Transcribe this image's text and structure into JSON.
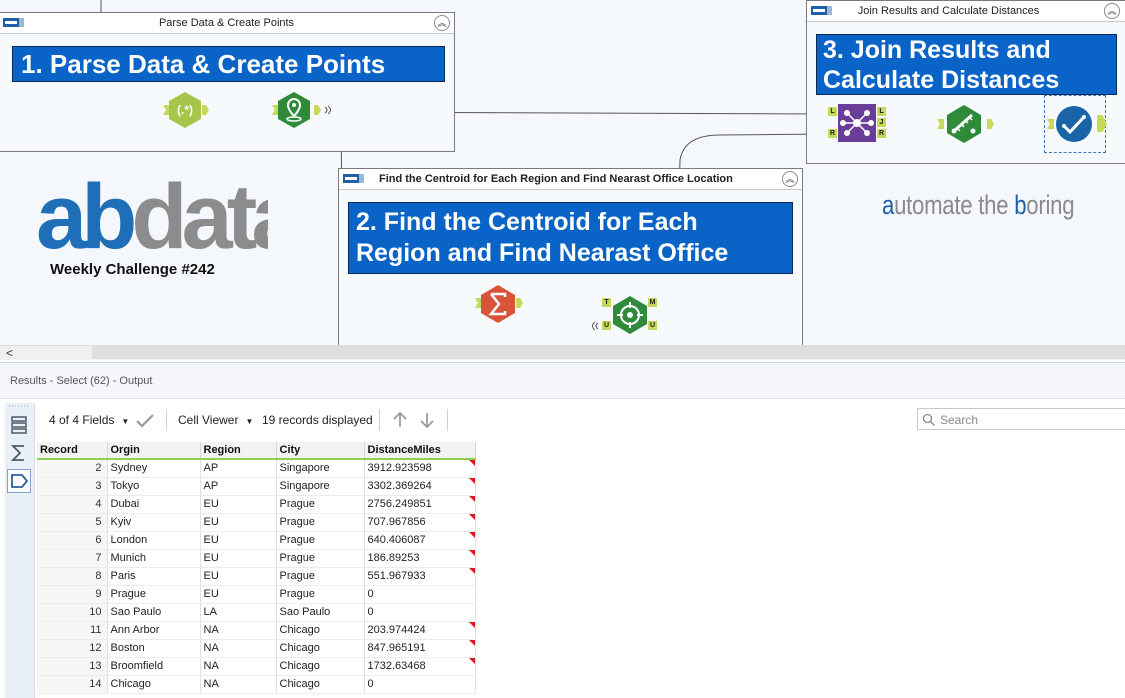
{
  "canvas": {
    "container1": {
      "title": "Parse Data & Create Points",
      "annotation": "1. Parse Data & Create Points"
    },
    "container2": {
      "title": "Find the Centroid for Each Region and Find Nearast Office Location",
      "annotation_line1": "2. Find the Centroid for Each",
      "annotation_line2": "Region and Find Nearast Office"
    },
    "container3": {
      "title": "Join Results and Calculate Distances",
      "annotation_line1": "3. Join Results and",
      "annotation_line2": "Calculate Distances"
    },
    "regex_tool_label": "(.*)",
    "logo_text": "abdata",
    "challenge_label": "Weekly Challenge #242",
    "tagline_parts": [
      "a",
      "utomate the ",
      "b",
      "oring"
    ],
    "anchor_labels": {
      "join_left": "L",
      "join_j": "J",
      "join_right": "R",
      "join_left_in": "L",
      "join_right_in": "R",
      "spatial_target": "T",
      "spatial_match": "M",
      "spatial_unmatched": "U",
      "spatial_universe": "U"
    },
    "icons": [
      "container-icon",
      "collapse-icon",
      "regex-icon",
      "create-points-icon",
      "summarize-icon",
      "spatial-match-icon",
      "join-icon",
      "distance-icon",
      "select-icon"
    ]
  },
  "scrollbar": {
    "left_arrow": "<"
  },
  "results": {
    "title": "Results - Select (62) - Output",
    "fields_label": "4 of 4 Fields",
    "cell_viewer_label": "Cell Viewer",
    "records_label": "19 records displayed",
    "search_placeholder": "Search",
    "columns": [
      "Record",
      "Orgin",
      "Region",
      "City",
      "DistanceMiles"
    ],
    "rows": [
      {
        "record": "2",
        "orgin": "Sydney",
        "region": "AP",
        "city": "Singapore",
        "distance": "3912.923598",
        "flag": true
      },
      {
        "record": "3",
        "orgin": "Tokyo",
        "region": "AP",
        "city": "Singapore",
        "distance": "3302.369264",
        "flag": true
      },
      {
        "record": "4",
        "orgin": "Dubai",
        "region": "EU",
        "city": "Prague",
        "distance": "2756.249851",
        "flag": true
      },
      {
        "record": "5",
        "orgin": "Kyiv",
        "region": "EU",
        "city": "Prague",
        "distance": "707.967856",
        "flag": true
      },
      {
        "record": "6",
        "orgin": "London",
        "region": "EU",
        "city": "Prague",
        "distance": "640.406087",
        "flag": true
      },
      {
        "record": "7",
        "orgin": "Munich",
        "region": "EU",
        "city": "Prague",
        "distance": "186.89253",
        "flag": true
      },
      {
        "record": "8",
        "orgin": "Paris",
        "region": "EU",
        "city": "Prague",
        "distance": "551.967933",
        "flag": true
      },
      {
        "record": "9",
        "orgin": "Prague",
        "region": "EU",
        "city": "Prague",
        "distance": "0",
        "flag": false
      },
      {
        "record": "10",
        "orgin": "Sao Paulo",
        "region": "LA",
        "city": "Sao Paulo",
        "distance": "0",
        "flag": false
      },
      {
        "record": "11",
        "orgin": "Ann Arbor",
        "region": "NA",
        "city": "Chicago",
        "distance": "203.974424",
        "flag": true
      },
      {
        "record": "12",
        "orgin": "Boston",
        "region": "NA",
        "city": "Chicago",
        "distance": "847.965191",
        "flag": true
      },
      {
        "record": "13",
        "orgin": "Broomfield",
        "region": "NA",
        "city": "Chicago",
        "distance": "1732.63468",
        "flag": true
      },
      {
        "record": "14",
        "orgin": "Chicago",
        "region": "NA",
        "city": "Chicago",
        "distance": "0",
        "flag": false
      }
    ]
  },
  "colors": {
    "annotation_blue": "#0a64c8",
    "logo_blue": "#1e6fb8",
    "logo_gray": "#8c8c8c",
    "tool_green": "#2f8a3a",
    "summarize_red": "#d9533a",
    "join_purple": "#6a3d9a",
    "select_blue": "#1b64a8",
    "anchor_lime": "#c7d95d"
  }
}
